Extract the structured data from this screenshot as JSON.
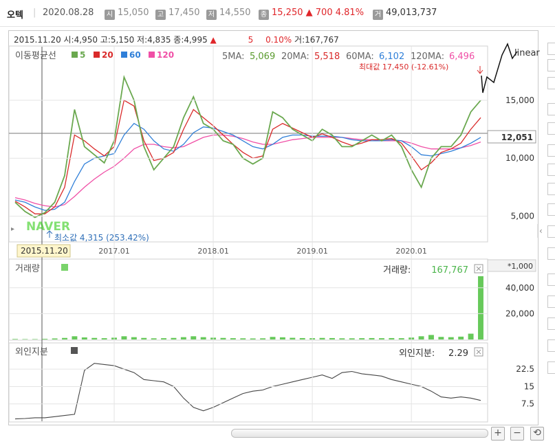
{
  "header": {
    "stock_name": "오텍",
    "date": "2020.08.28",
    "open_label": "시",
    "open": "15,050",
    "high_label": "고",
    "high": "17,450",
    "low_label": "저",
    "low": "14,550",
    "close_label": "종",
    "close": "15,250",
    "change_arrow": "▲",
    "change": "700",
    "change_pct": "4.81%",
    "volume_label": "거",
    "volume": "49,013,737"
  },
  "info_bar": {
    "text_a": "2015.11.20 시:4,950 고:5,150 저:4,835 종:4,995",
    "arrow": "▲",
    "change": "5",
    "pct": "0.10%",
    "vol": "거:167,767"
  },
  "price_panel": {
    "title": "이동평균선",
    "ma_legend": [
      {
        "label": "5",
        "color": "#6aa84f"
      },
      {
        "label": "20",
        "color": "#d92a2a"
      },
      {
        "label": "60",
        "color": "#2f7fd8"
      },
      {
        "label": "120",
        "color": "#f04fa6"
      }
    ],
    "ma_values": [
      {
        "label": "5MA:",
        "value": "5,069",
        "color": "#5a9b2e"
      },
      {
        "label": "20MA:",
        "value": "5,518",
        "color": "#d92a2a"
      },
      {
        "label": "60MA:",
        "value": "6,102",
        "color": "#2f7fd8"
      },
      {
        "label": "120MA:",
        "value": "6,496",
        "color": "#f04fa6"
      }
    ],
    "scale_mode": "linear",
    "max_annotation": "최대값 17,450 (-12.61%)",
    "min_annotation": "최소값 4,315 (253.42%)",
    "watermark": "NAVER",
    "cursor_date": "2015.11.20",
    "current_price_label": "12,051"
  },
  "volume_panel": {
    "title": "거래량",
    "value_label": "거래량:",
    "value": "167,767",
    "unit": "*1,000"
  },
  "foreign_panel": {
    "title": "외인지분",
    "value_label": "외인지분:",
    "value": "2.29"
  },
  "chart_data": [
    {
      "type": "line",
      "title": "이동평균선",
      "x_ticks": [
        "2017.01",
        "2018.01",
        "2019.01",
        "2020.01"
      ],
      "y_ticks": [
        5000,
        10000,
        15000
      ],
      "ylim": [
        2900,
        19500
      ],
      "x": [
        "2015.11",
        "2016.01",
        "2016.03",
        "2016.05",
        "2016.07",
        "2016.08",
        "2016.09",
        "2016.10",
        "2016.11",
        "2016.12",
        "2017.01",
        "2017.02",
        "2017.04",
        "2017.05",
        "2017.06",
        "2017.07",
        "2017.08",
        "2017.10",
        "2017.11",
        "2017.12",
        "2018.01",
        "2018.02",
        "2018.03",
        "2018.05",
        "2018.06",
        "2018.07",
        "2018.08",
        "2018.10",
        "2018.11",
        "2018.12",
        "2019.01",
        "2019.02",
        "2019.03",
        "2019.05",
        "2019.06",
        "2019.07",
        "2019.08",
        "2019.10",
        "2019.11",
        "2019.12",
        "2020.01",
        "2020.02",
        "2020.03",
        "2020.04",
        "2020.05",
        "2020.06",
        "2020.07",
        "2020.08"
      ],
      "series": [
        {
          "name": "5",
          "color": "#6aa84f",
          "values": [
            6200,
            5400,
            4900,
            5300,
            6200,
            8500,
            14200,
            11000,
            10300,
            9600,
            11500,
            17000,
            15000,
            11000,
            9000,
            10000,
            11000,
            13500,
            15300,
            13000,
            12500,
            11500,
            11200,
            10000,
            9500,
            10000,
            14000,
            13500,
            12500,
            12000,
            11500,
            12500,
            12000,
            11000,
            11000,
            11500,
            12000,
            11500,
            12000,
            11000,
            9000,
            7500,
            10000,
            11000,
            11000,
            12000,
            14000,
            15000
          ]
        },
        {
          "name": "20",
          "color": "#d92a2a",
          "values": [
            6300,
            5800,
            5200,
            5200,
            5800,
            7500,
            12000,
            11500,
            10800,
            10200,
            11000,
            15000,
            14500,
            11500,
            9800,
            10000,
            10500,
            12500,
            14200,
            13500,
            12800,
            12000,
            11200,
            10500,
            10000,
            10200,
            12500,
            13000,
            12600,
            12200,
            11800,
            12100,
            11800,
            11400,
            11100,
            11300,
            11600,
            11600,
            11700,
            11300,
            10200,
            9000,
            9600,
            10500,
            10800,
            11300,
            12500,
            13500
          ]
        },
        {
          "name": "60",
          "color": "#2f7fd8",
          "values": [
            6400,
            6200,
            5800,
            5500,
            5600,
            6200,
            8000,
            9500,
            10000,
            10200,
            10400,
            12000,
            13000,
            12500,
            11500,
            10800,
            10600,
            11200,
            12200,
            12700,
            12600,
            12300,
            12000,
            11500,
            11000,
            10800,
            11200,
            11800,
            12000,
            12000,
            11900,
            11900,
            11900,
            11800,
            11600,
            11500,
            11500,
            11500,
            11600,
            11500,
            11000,
            10300,
            10200,
            10400,
            10600,
            10900,
            11300,
            11800
          ]
        },
        {
          "name": "120",
          "color": "#f04fa6",
          "values": [
            6600,
            6400,
            6100,
            5900,
            5800,
            6000,
            6700,
            7500,
            8200,
            8800,
            9300,
            10000,
            10800,
            11200,
            11200,
            11000,
            10900,
            11000,
            11400,
            11800,
            12000,
            12000,
            11900,
            11700,
            11400,
            11200,
            11200,
            11400,
            11600,
            11700,
            11800,
            11800,
            11800,
            11800,
            11700,
            11600,
            11600,
            11500,
            11500,
            11500,
            11300,
            11000,
            10800,
            10800,
            10800,
            10900,
            11100,
            11400
          ]
        }
      ]
    },
    {
      "type": "bar",
      "title": "거래량",
      "y_ticks": [
        20000,
        40000
      ],
      "ylim": [
        0,
        50000
      ],
      "values": [
        400,
        300,
        300,
        500,
        800,
        1200,
        2500,
        1600,
        1200,
        1000,
        1400,
        2500,
        1800,
        1200,
        900,
        1000,
        1200,
        1800,
        2500,
        1800,
        1400,
        1200,
        1000,
        900,
        800,
        900,
        2000,
        1700,
        1300,
        1100,
        1000,
        1200,
        1100,
        900,
        900,
        1000,
        1100,
        1000,
        1100,
        1000,
        1500,
        2500,
        3500,
        2000,
        1800,
        2200,
        4500,
        49000
      ]
    },
    {
      "type": "line",
      "title": "외인지분",
      "y_ticks": [
        7.5,
        15.0,
        22.5
      ],
      "ylim": [
        0,
        27
      ],
      "values": [
        1.0,
        1.2,
        1.5,
        1.5,
        2.0,
        2.5,
        3.0,
        22.0,
        25.0,
        24.5,
        24.0,
        22.5,
        21.0,
        18.0,
        17.5,
        17.0,
        15.0,
        10.0,
        6.0,
        4.5,
        6.0,
        8.0,
        10.0,
        12.0,
        13.0,
        13.5,
        15.0,
        16.0,
        17.0,
        18.0,
        19.0,
        20.0,
        18.5,
        21.0,
        21.5,
        20.5,
        20.0,
        19.5,
        18.0,
        17.0,
        16.0,
        15.0,
        13.0,
        10.5,
        10.0,
        10.5,
        10.0,
        9.0
      ]
    }
  ]
}
